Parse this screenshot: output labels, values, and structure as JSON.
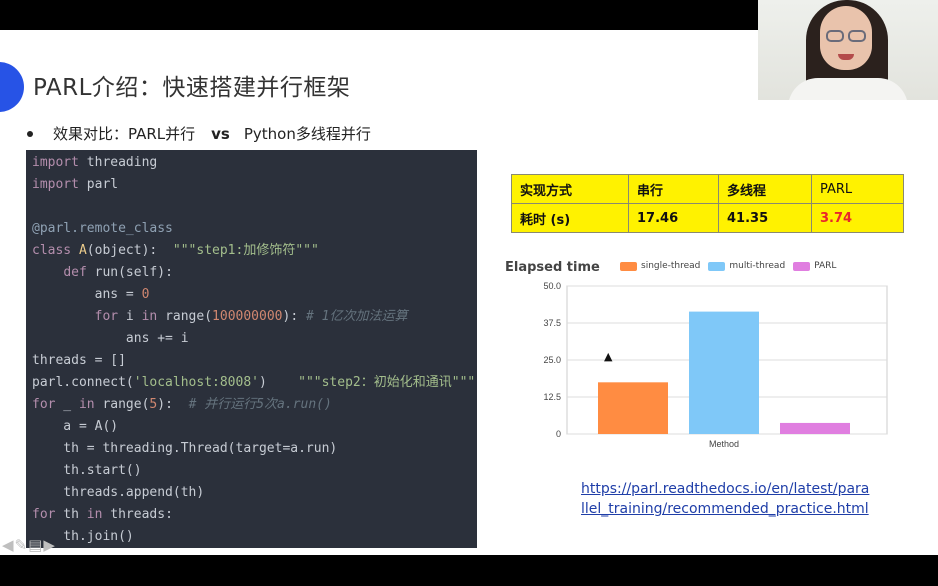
{
  "slide": {
    "title": "PARL介绍：快速搭建并行框架",
    "bullet": {
      "part1": "效果对比：PARL并行",
      "vs": "vs",
      "part2": "Python多线程并行"
    }
  },
  "code": {
    "lines": [
      {
        "parts": [
          [
            "kw",
            "import"
          ],
          [
            "plain",
            " threading"
          ]
        ]
      },
      {
        "parts": [
          [
            "kw",
            "import"
          ],
          [
            "plain",
            " parl"
          ]
        ]
      },
      {
        "parts": [
          [
            "plain",
            ""
          ]
        ]
      },
      {
        "parts": [
          [
            "dec",
            "@parl.remote_class"
          ]
        ]
      },
      {
        "parts": [
          [
            "kw",
            "class"
          ],
          [
            "plain",
            " "
          ],
          [
            "cls",
            "A"
          ],
          [
            "plain",
            "(object):  "
          ],
          [
            "str",
            "\"\"\"step1:加修饰符\"\"\""
          ]
        ]
      },
      {
        "parts": [
          [
            "plain",
            "    "
          ],
          [
            "kw",
            "def"
          ],
          [
            "plain",
            " run(self):"
          ]
        ]
      },
      {
        "parts": [
          [
            "plain",
            "        ans = "
          ],
          [
            "num",
            "0"
          ]
        ]
      },
      {
        "parts": [
          [
            "plain",
            "        "
          ],
          [
            "kw",
            "for"
          ],
          [
            "plain",
            " i "
          ],
          [
            "kw",
            "in"
          ],
          [
            "plain",
            " range("
          ],
          [
            "num",
            "100000000"
          ],
          [
            "plain",
            "): "
          ],
          [
            "cmt",
            "# 1亿次加法运算"
          ]
        ]
      },
      {
        "parts": [
          [
            "plain",
            "            ans += i"
          ]
        ]
      },
      {
        "parts": [
          [
            "plain",
            "threads = []"
          ]
        ]
      },
      {
        "parts": [
          [
            "plain",
            "parl.connect("
          ],
          [
            "str",
            "'localhost:8008'"
          ],
          [
            "plain",
            ")    "
          ],
          [
            "str",
            "\"\"\"step2：初始化和通讯\"\"\""
          ]
        ]
      },
      {
        "parts": [
          [
            "kw",
            "for"
          ],
          [
            "plain",
            " _ "
          ],
          [
            "kw",
            "in"
          ],
          [
            "plain",
            " range("
          ],
          [
            "num",
            "5"
          ],
          [
            "plain",
            "):  "
          ],
          [
            "cmt",
            "# 并行运行5次a.run()"
          ]
        ]
      },
      {
        "parts": [
          [
            "plain",
            "    a = A()"
          ]
        ]
      },
      {
        "parts": [
          [
            "plain",
            "    th = threading.Thread(target=a.run)"
          ]
        ]
      },
      {
        "parts": [
          [
            "plain",
            "    th.start()"
          ]
        ]
      },
      {
        "parts": [
          [
            "plain",
            "    threads.append(th)"
          ]
        ]
      },
      {
        "parts": [
          [
            "kw",
            "for"
          ],
          [
            "plain",
            " th "
          ],
          [
            "kw",
            "in"
          ],
          [
            "plain",
            " threads:"
          ]
        ]
      },
      {
        "parts": [
          [
            "plain",
            "    th.join()"
          ]
        ]
      }
    ]
  },
  "table": {
    "header": [
      "实现方式",
      "串行",
      "多线程",
      "PARL"
    ],
    "row": [
      "耗时 (s)",
      "17.46",
      "41.35",
      "3.74"
    ]
  },
  "chart_data": {
    "type": "bar",
    "title": "Elapsed time",
    "xlabel": "Method",
    "ylabel": "",
    "ylim": [
      0,
      50
    ],
    "yticks": [
      "50.0",
      "37.5",
      "25.0",
      "12.5",
      "0"
    ],
    "series": [
      {
        "name": "single-thread",
        "values": [
          17.46
        ],
        "color": "#ff8c42"
      },
      {
        "name": "multi-thread",
        "values": [
          41.35
        ],
        "color": "#7fc8f8"
      },
      {
        "name": "PARL",
        "values": [
          3.74
        ],
        "color": "#e07ee0"
      }
    ],
    "legend_position": "top",
    "grid": true
  },
  "link": {
    "line1": "https://parl.readthedocs.io/en/latest/para",
    "line2": "llel_training/recommended_practice.html"
  },
  "nav": {
    "back_icon": "back-arrow-icon",
    "pen_icon": "pen-icon",
    "menu_icon": "menu-icon",
    "forward_icon": "forward-arrow-icon"
  }
}
